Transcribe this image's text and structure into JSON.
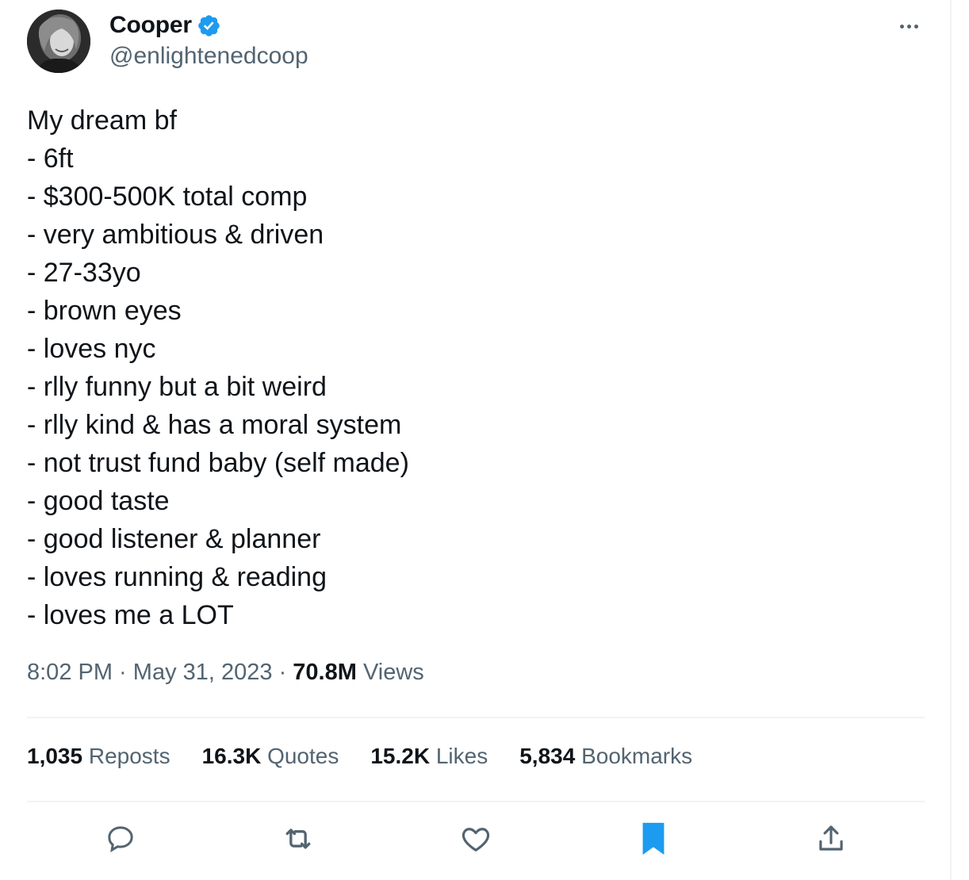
{
  "author": {
    "display_name": "Cooper",
    "handle": "@enlightenedcoop",
    "verified_icon": "verified-badge-icon",
    "avatar": "profile-photo"
  },
  "tweet": {
    "lines": [
      "My dream bf",
      "- 6ft",
      "- $300-500K total comp",
      "- very ambitious & driven",
      "- 27-33yo",
      "- brown eyes",
      "- loves nyc",
      "- rlly funny but a bit weird",
      "- rlly kind & has a moral system",
      "- not trust fund baby (self made)",
      "- good taste",
      "- good listener & planner",
      "- loves running & reading",
      "- loves me a LOT"
    ]
  },
  "meta": {
    "time": "8:02 PM",
    "separator": " · ",
    "date": "May 31, 2023",
    "views_count": "70.8M",
    "views_label": " Views"
  },
  "stats": {
    "reposts_count": "1,035",
    "reposts_label": " Reposts",
    "quotes_count": "16.3K",
    "quotes_label": " Quotes",
    "likes_count": "15.2K",
    "likes_label": " Likes",
    "bookmarks_count": "5,834",
    "bookmarks_label": " Bookmarks"
  },
  "actions": [
    "reply-icon",
    "repost-icon",
    "like-icon",
    "bookmark-icon",
    "share-icon"
  ],
  "colors": {
    "accent": "#1d9bf0",
    "text_primary": "#0f1419",
    "text_secondary": "#536471",
    "divider": "#eff3f4"
  }
}
